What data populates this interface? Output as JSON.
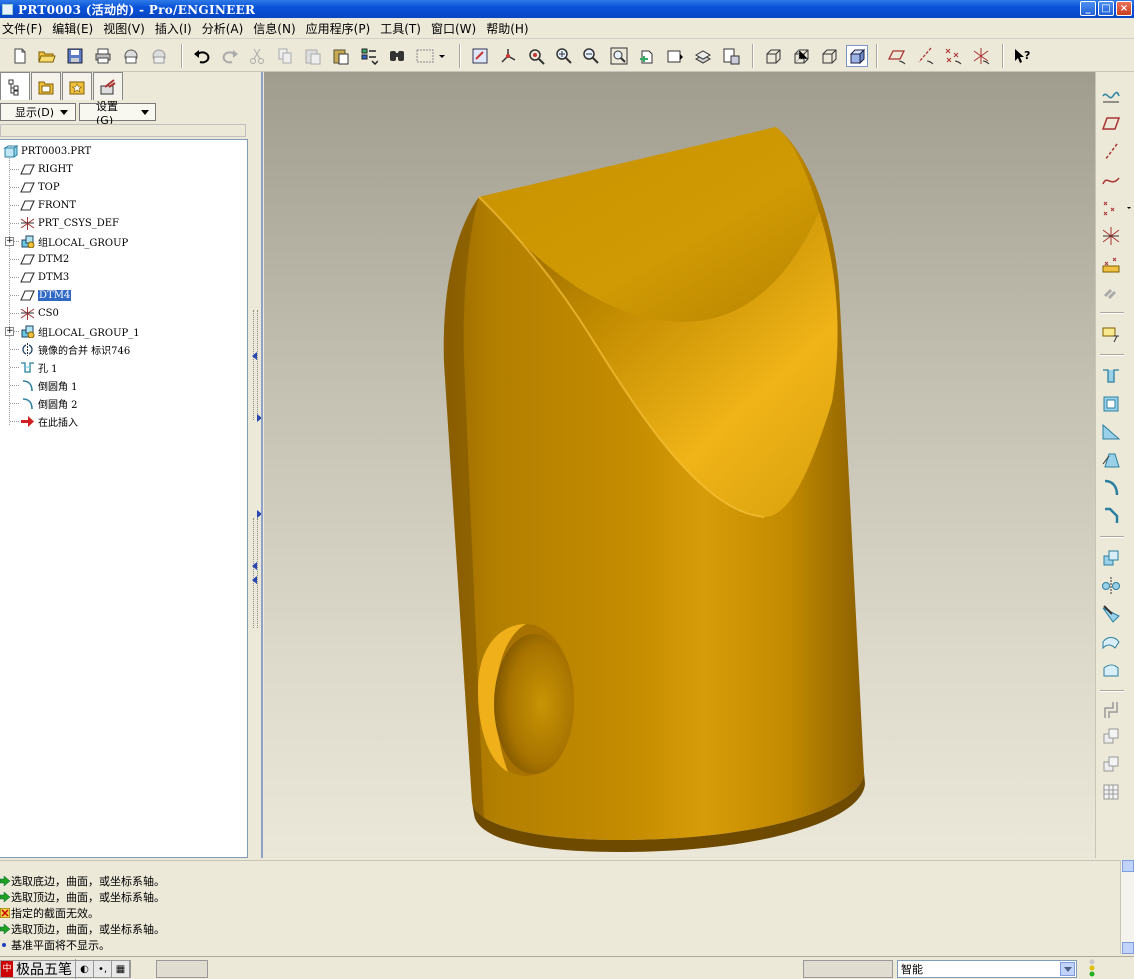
{
  "window": {
    "title": "PRT0003 (活动的) - Pro/ENGINEER",
    "buttons": [
      "minimize",
      "maximize",
      "close"
    ]
  },
  "menubar": {
    "items": [
      "文件(F)",
      "编辑(E)",
      "视图(V)",
      "插入(I)",
      "分析(A)",
      "信息(N)",
      "应用程序(P)",
      "工具(T)",
      "窗口(W)",
      "帮助(H)"
    ]
  },
  "toolbar": {
    "icons": [
      "new-icon",
      "open-icon",
      "save-icon",
      "print-icon",
      "send-mail-icon",
      "send-mail-attach-icon",
      "undo-icon",
      "redo-icon",
      "cut-icon",
      "copy-icon",
      "paste-icon",
      "paste-special-icon",
      "regenerate-icon",
      "find-icon",
      "select-box-icon",
      "redraw-icon",
      "spin-center-icon",
      "orient-mode-icon",
      "zoom-in-icon",
      "zoom-out-icon",
      "refit-icon",
      "reorient-icon",
      "saved-views-icon",
      "layers-icon",
      "view-manager-icon",
      "wireframe-icon",
      "hidden-line-icon",
      "no-hidden-icon",
      "shading-icon",
      "datum-planes-icon",
      "datum-axes-icon",
      "datum-points-icon",
      "coordinate-systems-icon",
      "whats-this-icon"
    ]
  },
  "model_tree": {
    "tabs": [
      "model-tree-tab",
      "folder-browser-tab",
      "favorites-tab",
      "connections-tab"
    ],
    "show_button": "显示(D)",
    "settings_button": "设置(G)",
    "root": "PRT0003.PRT",
    "items": [
      {
        "label": "RIGHT",
        "icon": "datum-plane-icon",
        "expandable": false,
        "selected": false
      },
      {
        "label": "TOP",
        "icon": "datum-plane-icon",
        "expandable": false,
        "selected": false
      },
      {
        "label": "FRONT",
        "icon": "datum-plane-icon",
        "expandable": false,
        "selected": false
      },
      {
        "label": "PRT_CSYS_DEF",
        "icon": "csys-icon",
        "expandable": false,
        "selected": false
      },
      {
        "label": "组LOCAL_GROUP",
        "icon": "group-icon",
        "expandable": true,
        "selected": false
      },
      {
        "label": "DTM2",
        "icon": "datum-plane-icon",
        "expandable": false,
        "selected": false
      },
      {
        "label": "DTM3",
        "icon": "datum-plane-icon",
        "expandable": false,
        "selected": false
      },
      {
        "label": "DTM4",
        "icon": "datum-plane-icon",
        "expandable": false,
        "selected": true
      },
      {
        "label": "CS0",
        "icon": "csys-icon",
        "expandable": false,
        "selected": false
      },
      {
        "label": "组LOCAL_GROUP_1",
        "icon": "group-icon",
        "expandable": true,
        "selected": false
      },
      {
        "label": "镜像的合并 标识746",
        "icon": "mirror-merge-icon",
        "expandable": false,
        "selected": false
      },
      {
        "label": "孔 1",
        "icon": "hole-icon",
        "expandable": false,
        "selected": false
      },
      {
        "label": "倒圆角 1",
        "icon": "round-icon",
        "expandable": false,
        "selected": false
      },
      {
        "label": "倒圆角 2",
        "icon": "round-icon",
        "expandable": false,
        "selected": false
      },
      {
        "label": "在此插入",
        "icon": "insert-here-icon",
        "expandable": false,
        "selected": false
      }
    ]
  },
  "right_toolbar": {
    "icons": [
      "sketch-icon",
      "datum-plane-icon",
      "datum-axis-icon",
      "datum-curve-icon",
      "datum-point-icon",
      "coordinate-system-icon",
      "analysis-feature-icon",
      "chain-icon",
      "annotation-icon",
      "hole-icon",
      "shell-icon",
      "rib-icon",
      "draft-icon",
      "round-icon",
      "chamfer-icon",
      "copy-icon",
      "mirror-icon",
      "merge-icon",
      "trim-icon",
      "extend-icon",
      "offset-icon",
      "thicken-icon",
      "solidify-icon",
      "pattern-icon"
    ]
  },
  "messages": [
    {
      "icon": "prompt-arrow",
      "text": "选取底边，曲面，或坐标系轴。"
    },
    {
      "icon": "prompt-arrow",
      "text": "选取顶边，曲面，或坐标系轴。"
    },
    {
      "icon": "error-icon",
      "text": "指定的截面无效。"
    },
    {
      "icon": "prompt-arrow",
      "text": "选取顶边，曲面，或坐标系轴。"
    },
    {
      "icon": "info-dot",
      "text": "基准平面将不显示。"
    }
  ],
  "statusbar": {
    "ime_name": "极品五笔",
    "filter_value": "智能"
  },
  "colors": {
    "model_gold": "#c89000",
    "selection": "#316ac5",
    "titlebar": "#0a53d8"
  }
}
